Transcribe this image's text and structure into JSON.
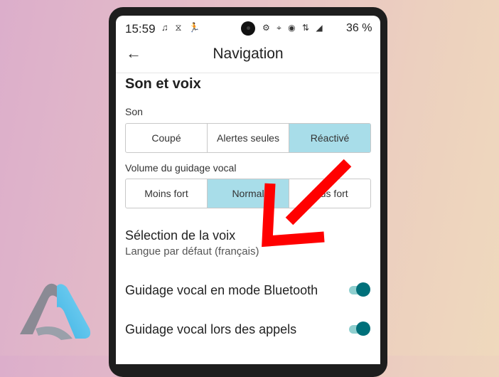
{
  "status": {
    "time": "15:59",
    "left_icons": "♫ ⧖ 🏃",
    "right_icons": "⚙ ⌖ ◉ ⇅ ◢",
    "battery": "36 %"
  },
  "appbar": {
    "back_icon": "←",
    "title": "Navigation"
  },
  "section": {
    "title": "Son et voix"
  },
  "sound": {
    "label": "Son",
    "options": [
      "Coupé",
      "Alertes seules",
      "Réactivé"
    ],
    "selected": 2
  },
  "volume": {
    "label": "Volume du guidage vocal",
    "options": [
      "Moins fort",
      "Normal",
      "Plus fort"
    ],
    "selected": 1
  },
  "voice": {
    "title": "Sélection de la voix",
    "subtitle": "Langue par défaut (français)"
  },
  "toggles": [
    {
      "label": "Guidage vocal en mode Bluetooth",
      "on": true
    },
    {
      "label": "Guidage vocal lors des appels",
      "on": true
    }
  ],
  "colors": {
    "accent": "#00707a",
    "selected_segment": "#a8dde9",
    "arrow": "#ff0000"
  }
}
